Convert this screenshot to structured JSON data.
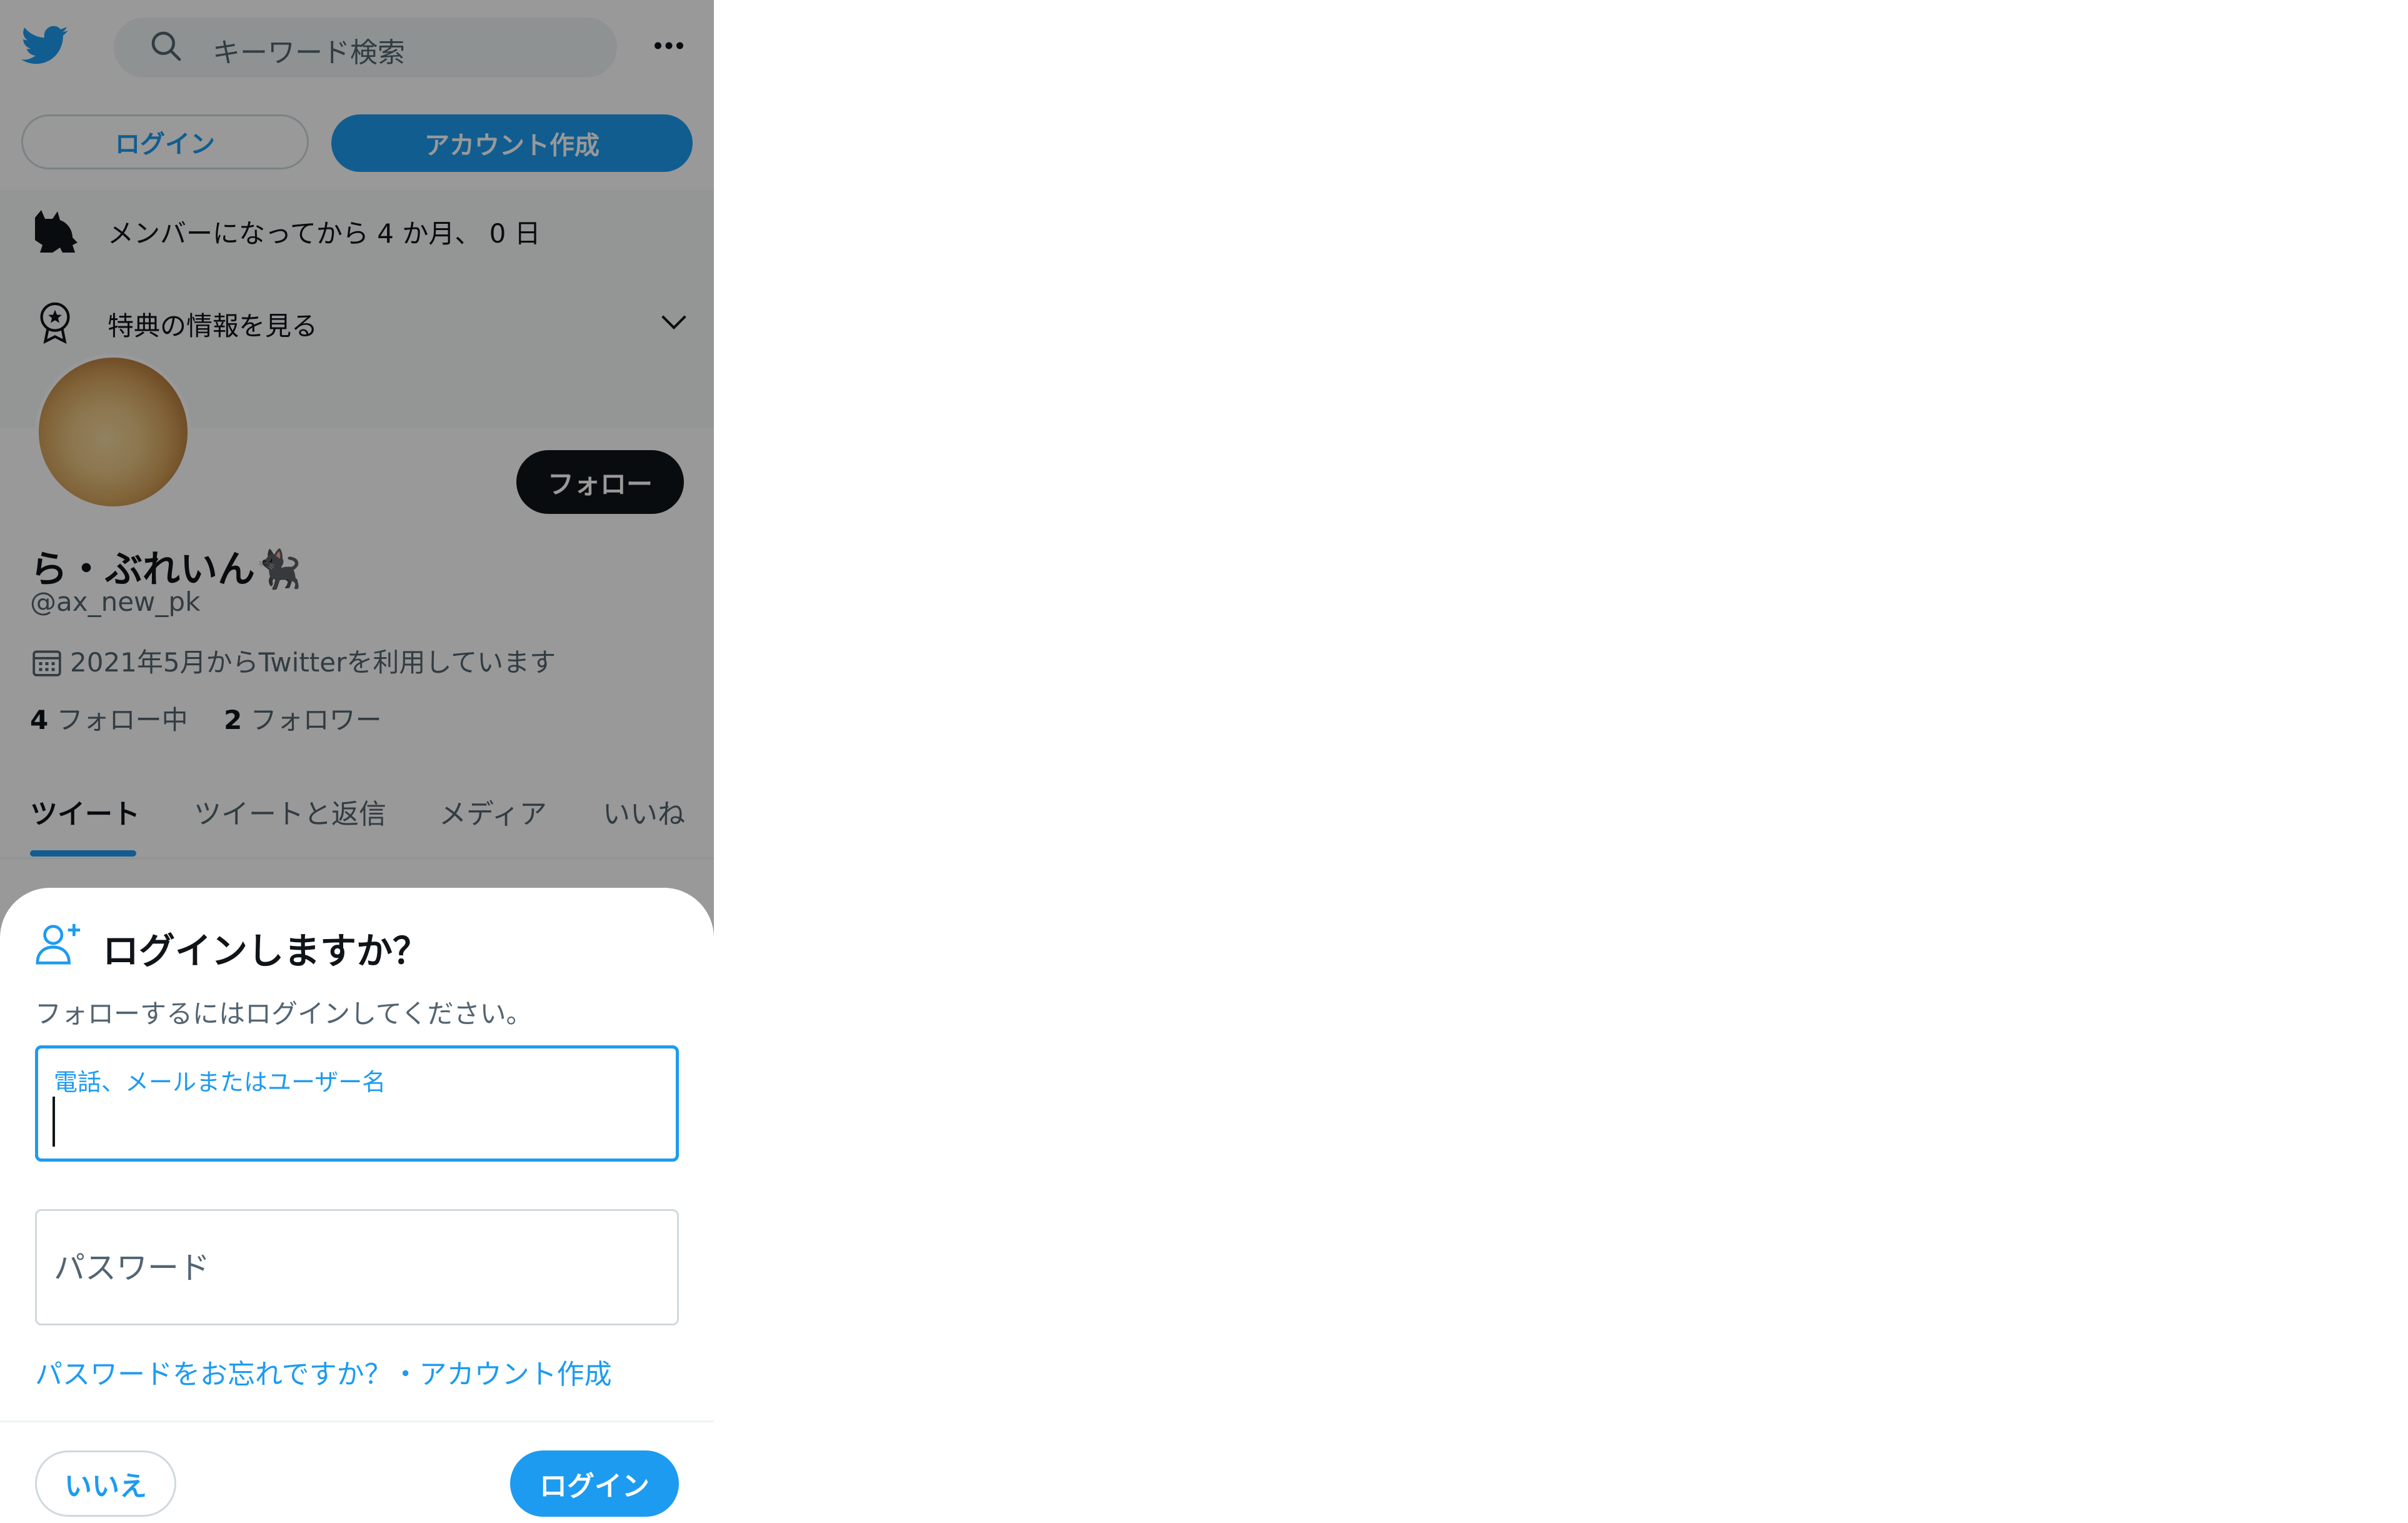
{
  "header": {
    "search_placeholder": "キーワード検索",
    "logo_icon": "twitter-bird-icon",
    "more_icon": "more-dots-icon"
  },
  "auth_buttons": {
    "login": "ログイン",
    "signup": "アカウント作成"
  },
  "member_info": {
    "text": "メンバーになってから 4 か月、 0 日",
    "icon": "cat-icon"
  },
  "benefits": {
    "text": "特典の情報を見る",
    "icon": "badge-icon",
    "expand_icon": "chevron-down-icon"
  },
  "profile": {
    "follow_label": "フォロー",
    "display_name": "ら・ぶれいん🐈‍⬛",
    "handle": "@ax_new_pk",
    "joined": "2021年5月からTwitterを利用しています",
    "following_count": "4",
    "following_label": "フォロー中",
    "followers_count": "2",
    "followers_label": "フォロワー"
  },
  "tabs": [
    {
      "label": "ツイート",
      "active": true
    },
    {
      "label": "ツイートと返信",
      "active": false
    },
    {
      "label": "メディア",
      "active": false
    },
    {
      "label": "いいね",
      "active": false
    }
  ],
  "login_sheet": {
    "title": "ログインしますか？",
    "subtitle": "フォローするにはログインしてください。",
    "username_label": "電話、メールまたはユーザー名",
    "username_value": "",
    "password_placeholder": "パスワード",
    "forgot_link": "パスワードをお忘れですか？・アカウント作成",
    "no_button": "いいえ",
    "login_button": "ログイン"
  },
  "colors": {
    "accent": "#1d9bf0",
    "text": "#0f1419",
    "muted": "#536471",
    "overlay": "rgba(0,0,0,0.40)"
  }
}
